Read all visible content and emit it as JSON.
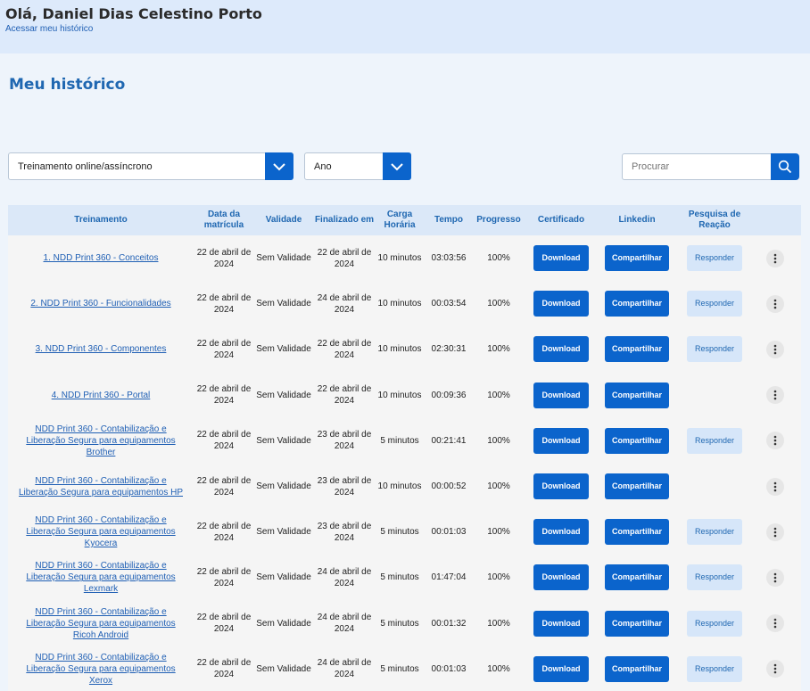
{
  "header": {
    "greeting": "Olá, Daniel Dias Celestino Porto",
    "history_link": "Acessar meu histórico"
  },
  "page_title": "Meu histórico",
  "filters": {
    "type_select": "Treinamento online/assíncrono",
    "year_select": "Ano",
    "search_placeholder": "Procurar"
  },
  "colors": {
    "accent": "#0b64cc",
    "header_bg": "#ddeafb",
    "page_bg": "#eef4fb"
  },
  "table": {
    "headers": {
      "treinamento": "Treinamento",
      "matricula": "Data da matrícula",
      "validade": "Validade",
      "finalizado": "Finalizado em",
      "carga": "Carga Horária",
      "tempo": "Tempo",
      "progresso": "Progresso",
      "certificado": "Certificado",
      "linkedin": "Linkedin",
      "pesquisa": "Pesquisa de Reação"
    },
    "labels": {
      "download": "Download",
      "share": "Compartilhar",
      "respond": "Responder"
    },
    "rows": [
      {
        "name": "1. NDD Print 360 - Conceitos",
        "matricula": "22 de abril de 2024",
        "validade": "Sem Validade",
        "finalizado": "22 de abril de 2024",
        "carga": "10 minutos",
        "tempo": "03:03:56",
        "progresso": "100%",
        "pesquisa": true
      },
      {
        "name": "2. NDD Print 360 - Funcionalidades",
        "matricula": "22 de abril de 2024",
        "validade": "Sem Validade",
        "finalizado": "24 de abril de 2024",
        "carga": "10 minutos",
        "tempo": "00:03:54",
        "progresso": "100%",
        "pesquisa": true
      },
      {
        "name": "3. NDD Print 360 - Componentes",
        "matricula": "22 de abril de 2024",
        "validade": "Sem Validade",
        "finalizado": "22 de abril de 2024",
        "carga": "10 minutos",
        "tempo": "02:30:31",
        "progresso": "100%",
        "pesquisa": true
      },
      {
        "name": "4. NDD Print 360 - Portal",
        "matricula": "22 de abril de 2024",
        "validade": "Sem Validade",
        "finalizado": "22 de abril de 2024",
        "carga": "10 minutos",
        "tempo": "00:09:36",
        "progresso": "100%",
        "pesquisa": false
      },
      {
        "name": "NDD Print 360 - Contabilização e Liberação Segura para equipamentos Brother",
        "matricula": "22 de abril de 2024",
        "validade": "Sem Validade",
        "finalizado": "23 de abril de 2024",
        "carga": "5 minutos",
        "tempo": "00:21:41",
        "progresso": "100%",
        "pesquisa": true
      },
      {
        "name": "NDD Print 360 - Contabilização e Liberação Segura para equipamentos HP",
        "matricula": "22 de abril de 2024",
        "validade": "Sem Validade",
        "finalizado": "23 de abril de 2024",
        "carga": "10 minutos",
        "tempo": "00:00:52",
        "progresso": "100%",
        "pesquisa": false
      },
      {
        "name": "NDD Print 360 - Contabilização e Liberação Segura para equipamentos Kyocera",
        "matricula": "22 de abril de 2024",
        "validade": "Sem Validade",
        "finalizado": "23 de abril de 2024",
        "carga": "5 minutos",
        "tempo": "00:01:03",
        "progresso": "100%",
        "pesquisa": true
      },
      {
        "name": "NDD Print 360 - Contabilização e Liberação Segura para equipamentos Lexmark",
        "matricula": "22 de abril de 2024",
        "validade": "Sem Validade",
        "finalizado": "24 de abril de 2024",
        "carga": "5 minutos",
        "tempo": "01:47:04",
        "progresso": "100%",
        "pesquisa": true
      },
      {
        "name": "NDD Print 360 - Contabilização e Liberação Segura para equipamentos Ricoh Android",
        "matricula": "22 de abril de 2024",
        "validade": "Sem Validade",
        "finalizado": "24 de abril de 2024",
        "carga": "5 minutos",
        "tempo": "00:01:32",
        "progresso": "100%",
        "pesquisa": true
      },
      {
        "name": "NDD Print 360 - Contabilização e Liberação Segura para equipamentos Xerox",
        "matricula": "22 de abril de 2024",
        "validade": "Sem Validade",
        "finalizado": "24 de abril de 2024",
        "carga": "5 minutos",
        "tempo": "00:01:03",
        "progresso": "100%",
        "pesquisa": true
      }
    ]
  }
}
